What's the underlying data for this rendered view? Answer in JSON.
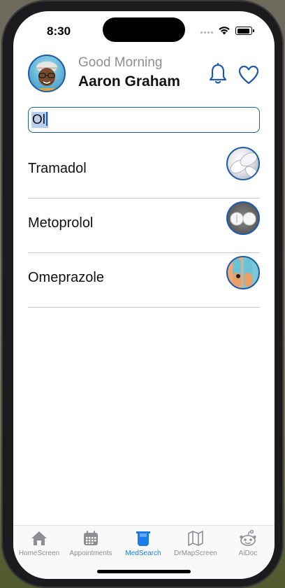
{
  "status_bar": {
    "time": "8:30"
  },
  "header": {
    "greeting": "Good Morning",
    "user_name": "Aaron Graham"
  },
  "search": {
    "value": "Ol"
  },
  "medications": [
    {
      "name": "Tramadol",
      "thumbnail": "tramadol-pill-image"
    },
    {
      "name": "Metoprolol",
      "thumbnail": "metoprolol-pill-image"
    },
    {
      "name": "Omeprazole",
      "thumbnail": "omeprazole-capsule-image"
    }
  ],
  "tabs": [
    {
      "label": "HomeScreen",
      "icon": "house-icon",
      "active": false
    },
    {
      "label": "Appointments",
      "icon": "calendar-icon",
      "active": false
    },
    {
      "label": "MedSearch",
      "icon": "beaker-icon",
      "active": true
    },
    {
      "label": "DrMapScreen",
      "icon": "map-icon",
      "active": false
    },
    {
      "label": "AiDoc",
      "icon": "robot-icon",
      "active": false
    }
  ],
  "colors": {
    "accent": "#1f5ba8",
    "active_tab": "#1a7ce8",
    "inactive_tab": "#8e8e93"
  }
}
